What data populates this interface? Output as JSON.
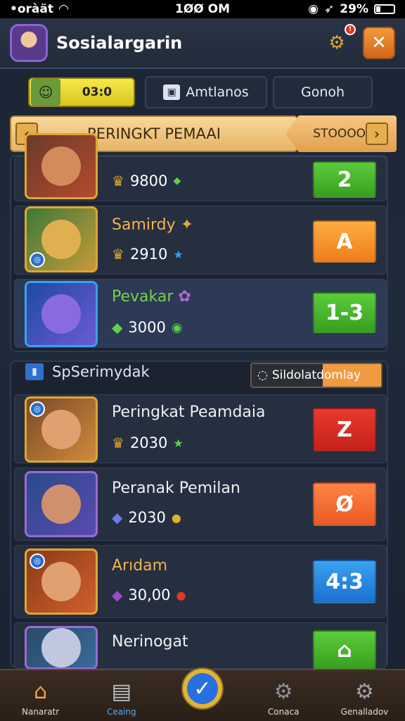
{
  "status_bar": {
    "carrier": "•oràät",
    "time": "1ØØ OM",
    "battery": "29%"
  },
  "header": {
    "title": "Sosialargarin",
    "gear_badge": "!",
    "close_symbol": "✕"
  },
  "tabs": {
    "timer": "03:0",
    "tab1": "Amtlanos",
    "tab2": "Gonoh"
  },
  "banner": {
    "title": "PERINGKT PEMAAI",
    "right_label": "STOOOO",
    "left_arrow": "‹",
    "right_arrow": "›"
  },
  "top_rows": [
    {
      "name": "",
      "score": "9800",
      "rank": "2",
      "rank_color": "green",
      "accent": "#b54a2c"
    },
    {
      "name": "Samirdy",
      "score": "2910",
      "rank": "A",
      "rank_color": "orange",
      "accent": "#c89a3a"
    },
    {
      "name": "Pevakar",
      "score": "3000",
      "rank": "1-3",
      "rank_color": "green",
      "accent": "#6a5ad6"
    }
  ],
  "section": {
    "title": "SpSerimydak",
    "pill": "Sildolatdomlay"
  },
  "bottom_rows": [
    {
      "name": "Peringkat Peamdaia",
      "score": "2030",
      "rank": "Z",
      "rank_color": "red",
      "accent": "#d08a3a"
    },
    {
      "name": "Peranak Pemilan",
      "score": "2030",
      "rank": "Ø",
      "rank_color": "orange2",
      "accent": "#5a4ab0"
    },
    {
      "name": "Arıdam",
      "score": "30,00",
      "rank": "4:3",
      "rank_color": "blue",
      "accent": "#d0602a"
    },
    {
      "name": "Nerinogat",
      "score": "",
      "rank": "⌂",
      "rank_color": "green",
      "accent": "#3a6a9a"
    }
  ],
  "nav": [
    {
      "label": "Nanaratr",
      "icon": "home-icon"
    },
    {
      "label": "Ceaing",
      "icon": "list-icon"
    },
    {
      "label": "",
      "icon": "check-icon"
    },
    {
      "label": "Conaca",
      "icon": "gear-icon"
    },
    {
      "label": "Genalladov",
      "icon": "settings-icon"
    }
  ]
}
